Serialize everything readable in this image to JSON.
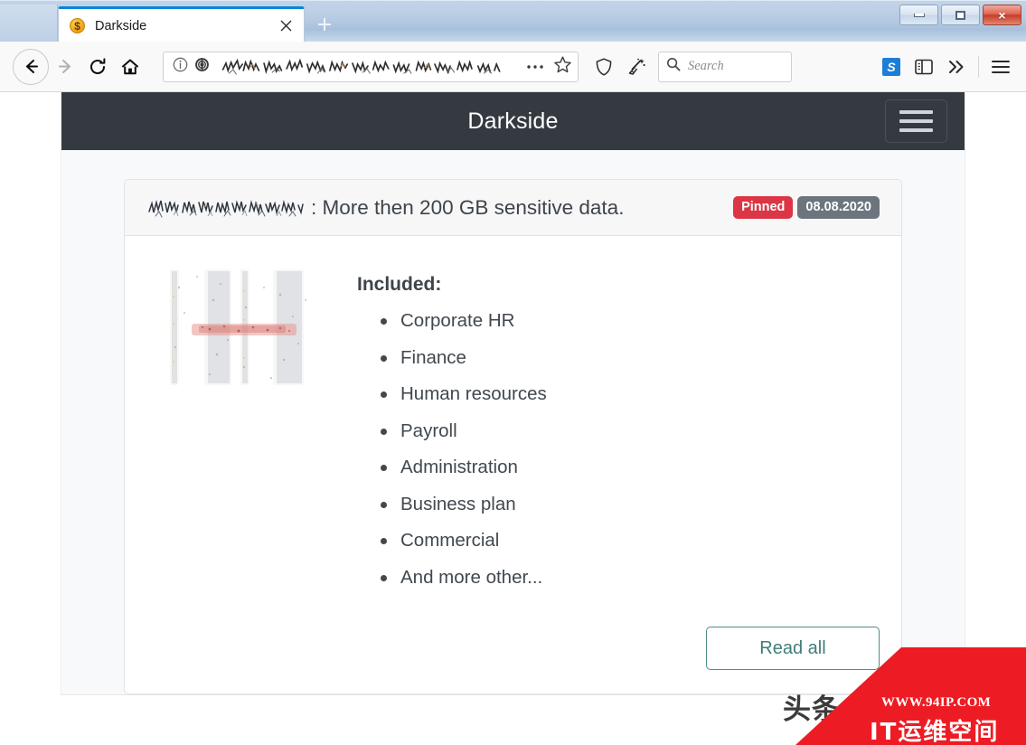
{
  "browser": {
    "tab": {
      "title": "Darkside",
      "favicon": "dollar-coin-icon",
      "close_label": "×"
    },
    "newtab_label": "+",
    "window_controls": {
      "minimize": "minimize-icon",
      "maximize": "maximize-icon",
      "close": "×"
    },
    "toolbar": {
      "back": "back-arrow-icon",
      "forward": "forward-arrow-icon",
      "reload": "reload-icon",
      "home": "home-icon",
      "identity": "info-circle-icon",
      "onion": "onion-tor-icon",
      "url_value": "",
      "page_actions": "ellipsis-icon",
      "bookmark": "star-icon",
      "shield": "shield-icon",
      "forget": "broom-sparkle-icon",
      "extension_label": "S",
      "sidebar": "sidebar-icon",
      "overflow": "»",
      "menu": "hamburger-menu-icon"
    },
    "search": {
      "placeholder": "Search",
      "icon": "search-icon",
      "value": ""
    }
  },
  "site": {
    "navbar": {
      "brand": "Darkside",
      "toggler": "hamburger-toggler-icon"
    },
    "post": {
      "victim_name_redacted": "",
      "headline": ": More then 200 GB sensitive data.",
      "badges": {
        "pinned": "Pinned",
        "date": "08.08.2020"
      },
      "thumbnail": "redacted-company-logo-image",
      "included_label": "Included:",
      "included_items": [
        "Corporate HR",
        "Finance",
        "Human resources",
        "Payroll",
        "Administration",
        "Business plan",
        "Commercial",
        "And more other..."
      ],
      "read_all_label": "Read all"
    }
  },
  "watermarks": {
    "toutiao": "头条 @博",
    "url": "WWW.94IP.COM",
    "chinese": "IT运维空间"
  },
  "colors": {
    "navbar_bg": "#343a40",
    "pinned_badge": "#dc3545",
    "date_badge": "#6c757d",
    "read_all_border": "#4f8d87",
    "watermark_red": "#ed1c24",
    "page_bg": "#f8f9fa"
  }
}
